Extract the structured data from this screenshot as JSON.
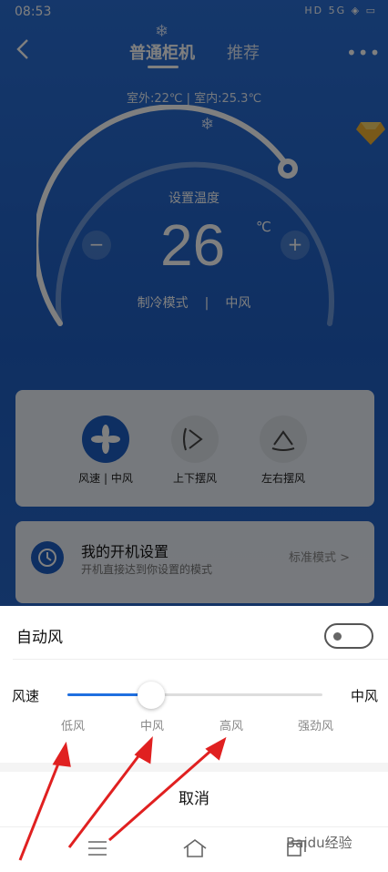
{
  "status": {
    "time": "08:53",
    "icons_text": "HD 5G ◈ ▭"
  },
  "header": {
    "tabs": [
      {
        "label": "普通柜机",
        "active": true
      },
      {
        "label": "推荐",
        "active": false
      }
    ],
    "more_glyph": "•••"
  },
  "temperature": {
    "info": "室外:22℃ | 室内:25.3℃",
    "set_label": "设置温度",
    "value": "26",
    "unit": "℃",
    "minus": "−",
    "plus": "+",
    "mode": "制冷模式",
    "divider": "|",
    "fan": "中风"
  },
  "controls": {
    "items": [
      {
        "label": "风速 | 中风",
        "icon": "fan-icon",
        "active": true
      },
      {
        "label": "上下摆风",
        "icon": "vertical-swing-icon",
        "active": false
      },
      {
        "label": "左右摆风",
        "icon": "horizontal-swing-icon",
        "active": false
      }
    ]
  },
  "startup": {
    "title": "我的开机设置",
    "subtitle": "开机直接达到你设置的模式",
    "right": "标准模式 >"
  },
  "sheet": {
    "auto_label": "自动风",
    "auto_enabled": false,
    "speed_label": "风速",
    "speed_value": "中风",
    "slider_position": 0.33,
    "ticks": [
      "低风",
      "中风",
      "高风",
      "强劲风"
    ],
    "cancel": "取消"
  },
  "watermark": "Baidu经验",
  "colors": {
    "accent": "#1f6fe0",
    "arrow": "#e02020",
    "bg_blue": "#2a6fd6"
  }
}
